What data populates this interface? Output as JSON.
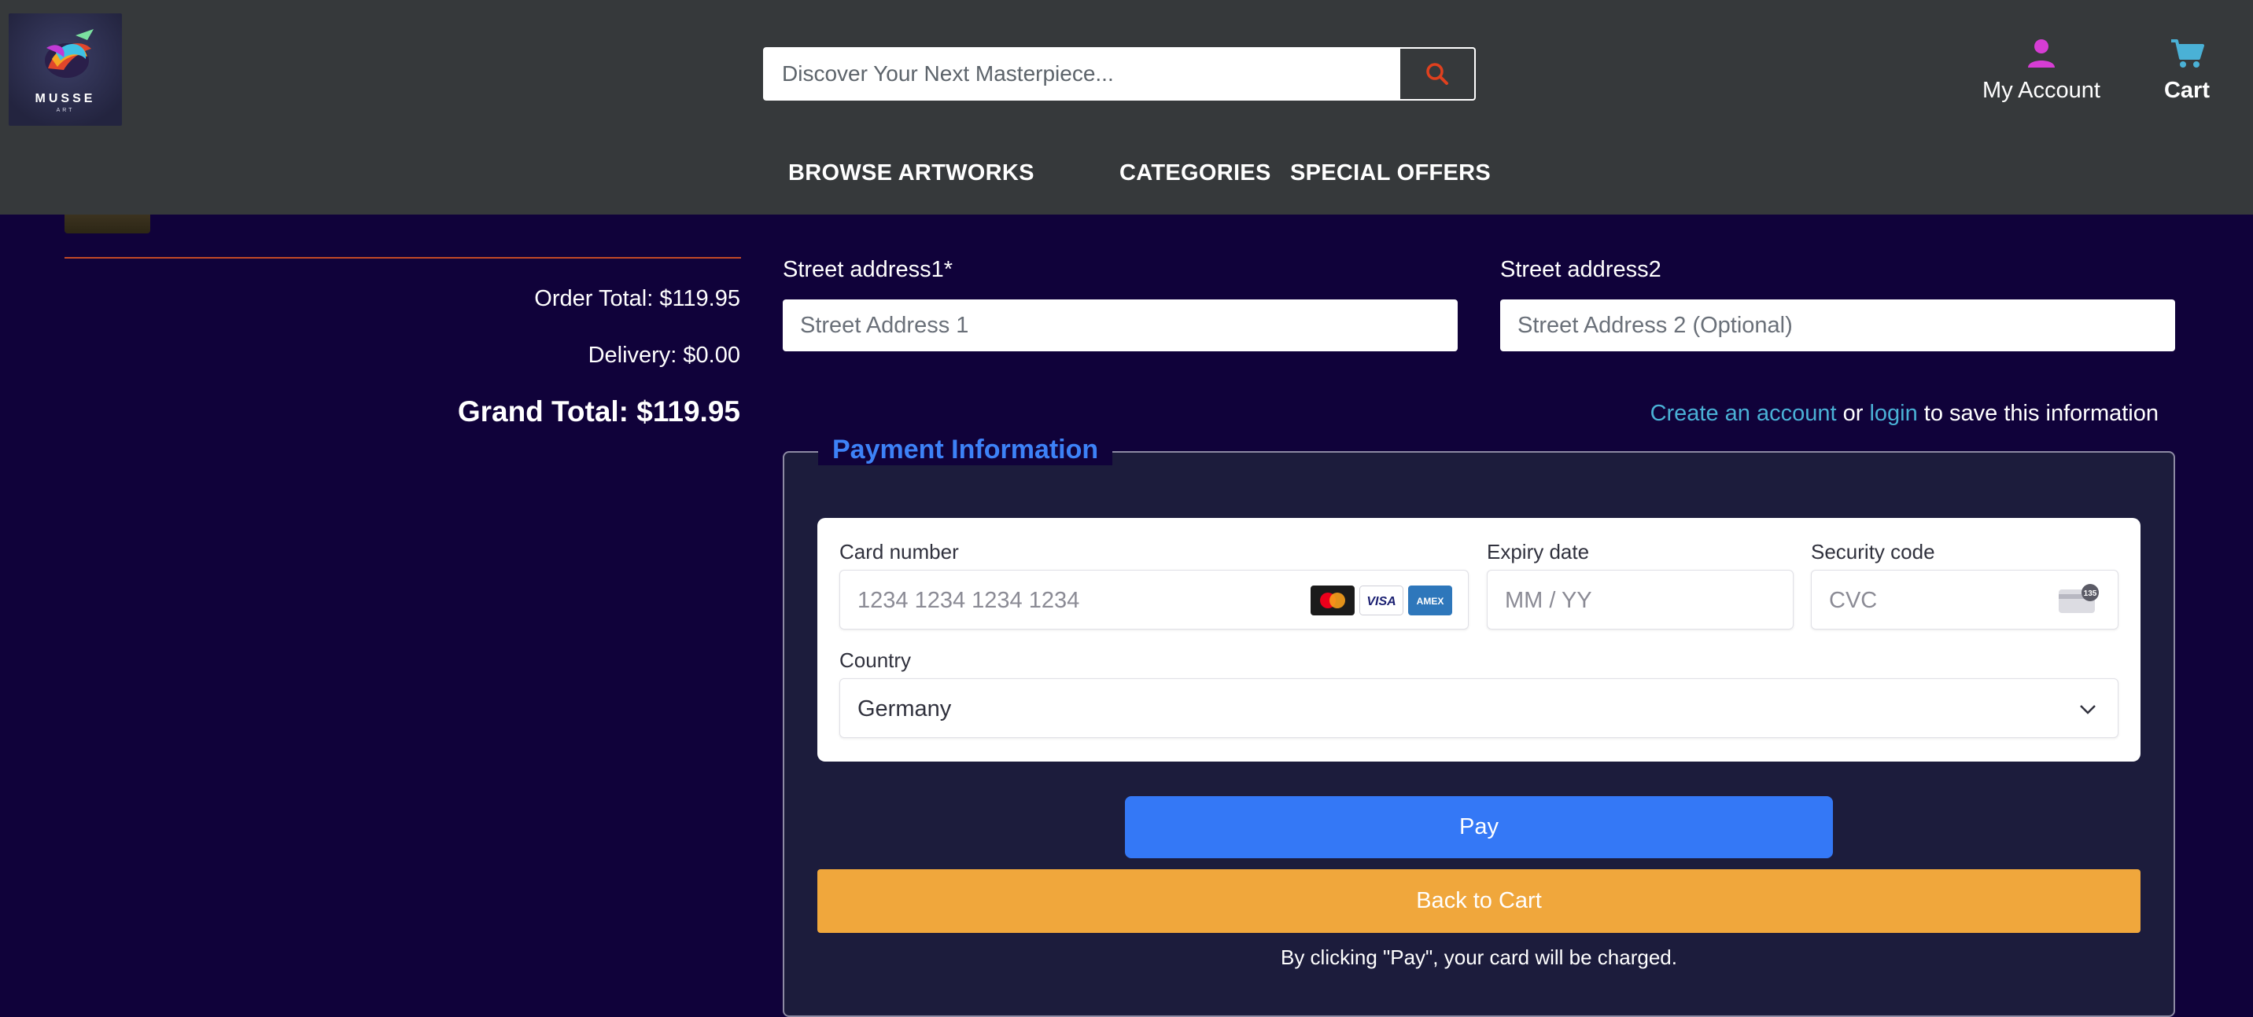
{
  "header": {
    "logo_text": "MUSSE",
    "logo_subtext": "ART",
    "search_placeholder": "Discover Your Next Masterpiece...",
    "account_label": "My Account",
    "cart_label": "Cart",
    "nav": [
      "BROWSE ARTWORKS",
      "CATEGORIES",
      "SPECIAL OFFERS"
    ]
  },
  "summary": {
    "order_total": "Order Total: $119.95",
    "delivery": "Delivery: $0.00",
    "grand_total": "Grand Total: $119.95"
  },
  "address": {
    "street1_label": "Street address1*",
    "street1_placeholder": "Street Address 1",
    "street2_label": "Street address2",
    "street2_placeholder": "Street Address 2 (Optional)"
  },
  "save_info": {
    "create_link": "Create an account",
    "or_text": " or ",
    "login_link": "login",
    "suffix": " to save this information"
  },
  "payment": {
    "legend": "Payment Information",
    "card_number_label": "Card number",
    "card_number_placeholder": "1234 1234 1234 1234",
    "expiry_label": "Expiry date",
    "expiry_placeholder": "MM / YY",
    "security_label": "Security code",
    "security_placeholder": "CVC",
    "cvc_icon_text": "135",
    "country_label": "Country",
    "country_value": "Germany",
    "card_brands": [
      "VISA",
      "AMEX"
    ],
    "pay_label": "Pay",
    "back_label": "Back to Cart",
    "disclaimer": "By clicking \"Pay\", your card will be charged."
  },
  "colors": {
    "page_bg": "#10023a",
    "header_bg": "#36393b",
    "link": "#4ab1d6",
    "legend": "#3d82f7",
    "pay_button": "#3478f6",
    "back_button": "#f0a73c",
    "account_icon": "#d63dd4",
    "cart_icon": "#4ab1d6",
    "search_icon": "#e0401e"
  }
}
